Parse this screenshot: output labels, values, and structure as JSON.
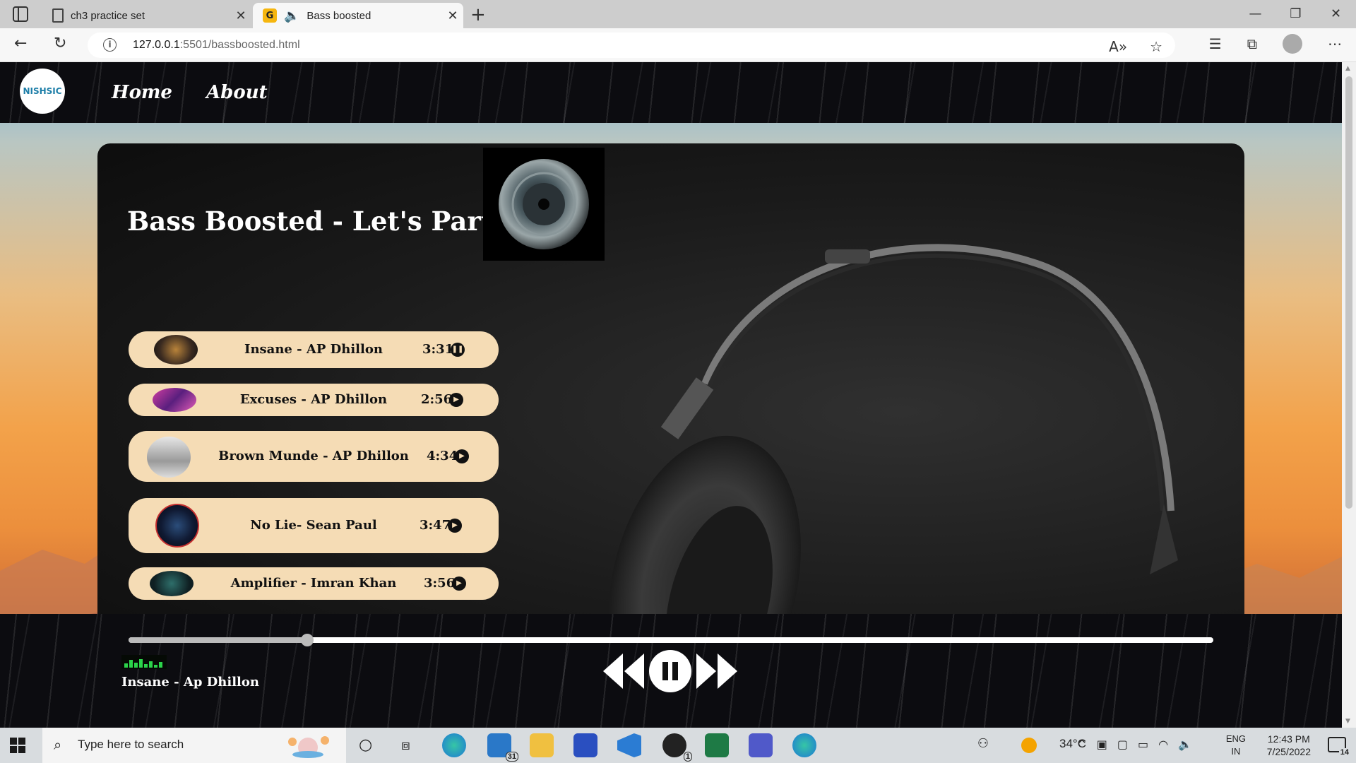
{
  "browser": {
    "tabs": [
      {
        "title": "ch3 practice set",
        "active": false
      },
      {
        "title": "Bass boosted",
        "active": true
      }
    ],
    "url_host": "127.0.0.1",
    "url_rest": ":5501/bassboosted.html",
    "window_buttons": [
      "minimize-icon",
      "restore-icon",
      "close-icon"
    ]
  },
  "site": {
    "logo_text": "NISHSIC",
    "nav": [
      "Home",
      "About"
    ],
    "heading": "Bass Boosted - Let's Party",
    "songs": [
      {
        "name": "Insane - AP Dhillon",
        "duration": "3:31",
        "state": "pause-icon"
      },
      {
        "name": "Excuses - AP Dhillon",
        "duration": "2:56",
        "state": "play-icon"
      },
      {
        "name": "Brown Munde - AP Dhillon",
        "duration": "4:34",
        "state": "play-icon"
      },
      {
        "name": "No Lie- Sean Paul",
        "duration": "3:47",
        "state": "play-icon"
      },
      {
        "name": "Amplifier - Imran Khan",
        "duration": "3:56",
        "state": "play-icon"
      }
    ],
    "player": {
      "now_playing": "Insane - Ap Dhillon",
      "progress_fraction": 0.165,
      "controls": [
        "backward-icon",
        "pause-icon",
        "forward-icon"
      ]
    }
  },
  "taskbar": {
    "search_placeholder": "Type here to search",
    "mail_badge": "31",
    "xbox_badge": "1",
    "temperature": "34°C",
    "lang_top": "ENG",
    "lang_bottom": "IN",
    "time": "12:43 PM",
    "date": "7/25/2022",
    "notification_count": "14"
  },
  "colors": {
    "song_card": "#f5dcb5",
    "card_text": "#111111",
    "accent_green": "#2bd34a"
  }
}
